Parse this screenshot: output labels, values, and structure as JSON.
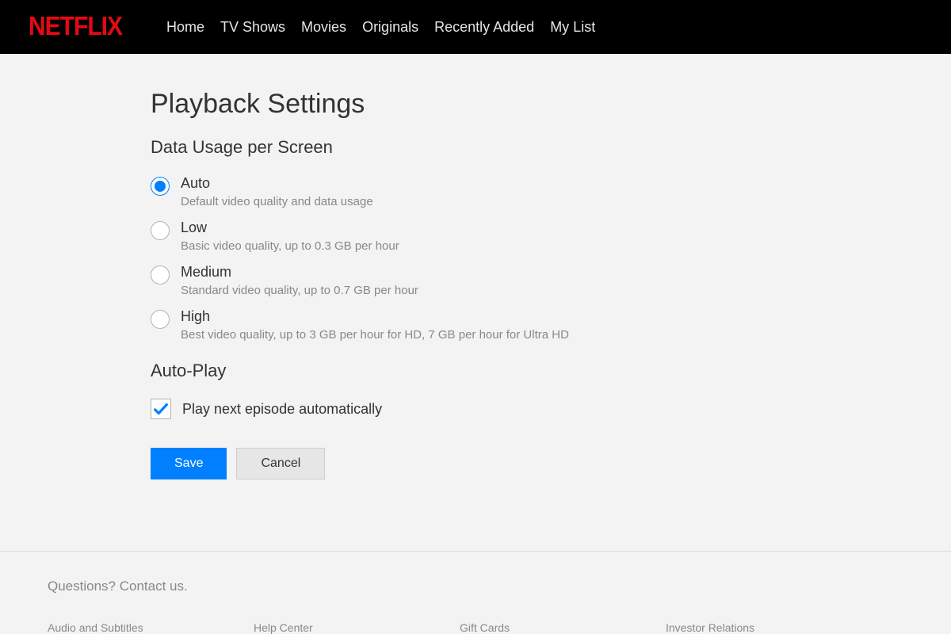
{
  "header": {
    "logo": "NETFLIX",
    "nav": [
      "Home",
      "TV Shows",
      "Movies",
      "Originals",
      "Recently Added",
      "My List"
    ]
  },
  "page": {
    "title": "Playback Settings"
  },
  "data_usage": {
    "title": "Data Usage per Screen",
    "options": [
      {
        "label": "Auto",
        "description": "Default video quality and data usage",
        "selected": true
      },
      {
        "label": "Low",
        "description": "Basic video quality, up to 0.3 GB per hour",
        "selected": false
      },
      {
        "label": "Medium",
        "description": "Standard video quality, up to 0.7 GB per hour",
        "selected": false
      },
      {
        "label": "High",
        "description": "Best video quality, up to 3 GB per hour for HD, 7 GB per hour for Ultra HD",
        "selected": false
      }
    ]
  },
  "autoplay": {
    "title": "Auto-Play",
    "checkbox_label": "Play next episode automatically",
    "checked": true
  },
  "buttons": {
    "save": "Save",
    "cancel": "Cancel"
  },
  "footer": {
    "question": "Questions? Contact us.",
    "links": [
      "Audio and Subtitles",
      "Help Center",
      "Gift Cards",
      "Investor Relations"
    ]
  }
}
